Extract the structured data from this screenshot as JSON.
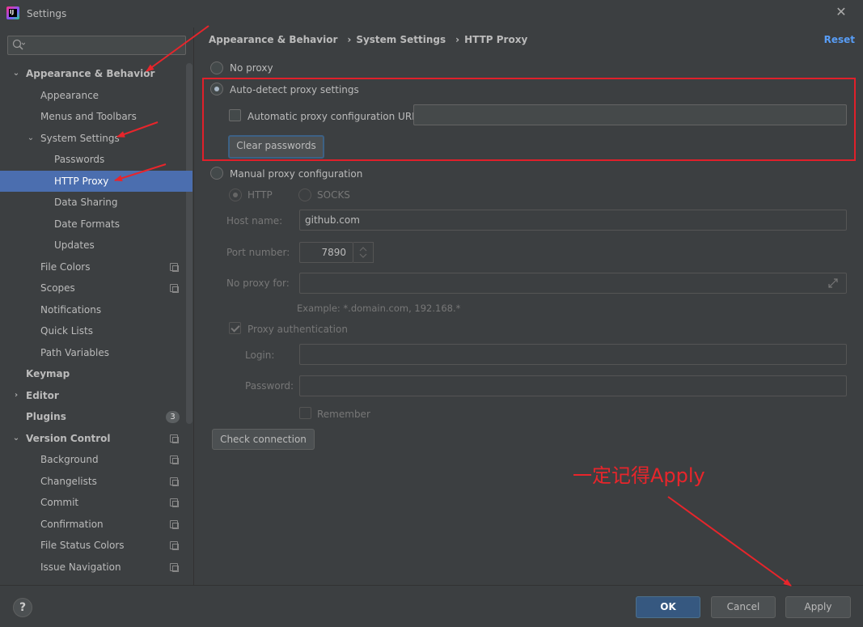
{
  "window": {
    "title": "Settings",
    "logo_text": "IJ"
  },
  "sidebar": {
    "search": {
      "value": "",
      "placeholder": ""
    },
    "items": [
      {
        "label": "Appearance & Behavior",
        "expanded": true
      },
      {
        "label": "Appearance"
      },
      {
        "label": "Menus and Toolbars"
      },
      {
        "label": "System Settings",
        "expanded": true
      },
      {
        "label": "Passwords"
      },
      {
        "label": "HTTP Proxy",
        "selected": true
      },
      {
        "label": "Data Sharing"
      },
      {
        "label": "Date Formats"
      },
      {
        "label": "Updates"
      },
      {
        "label": "File Colors"
      },
      {
        "label": "Scopes"
      },
      {
        "label": "Notifications"
      },
      {
        "label": "Quick Lists"
      },
      {
        "label": "Path Variables"
      },
      {
        "label": "Keymap"
      },
      {
        "label": "Editor",
        "expanded": false
      },
      {
        "label": "Plugins",
        "badge": "3"
      },
      {
        "label": "Version Control",
        "expanded": true
      },
      {
        "label": "Background"
      },
      {
        "label": "Changelists"
      },
      {
        "label": "Commit"
      },
      {
        "label": "Confirmation"
      },
      {
        "label": "File Status Colors"
      },
      {
        "label": "Issue Navigation"
      }
    ]
  },
  "breadcrumb": [
    "Appearance & Behavior",
    "System Settings",
    "HTTP Proxy"
  ],
  "reset_label": "Reset",
  "proxy": {
    "no_proxy_label": "No proxy",
    "auto_detect_label": "Auto-detect proxy settings",
    "auto_config_url_label": "Automatic proxy configuration URL:",
    "auto_config_url_value": "",
    "clear_passwords_label": "Clear passwords",
    "manual_label": "Manual proxy configuration",
    "http_label": "HTTP",
    "socks_label": "SOCKS",
    "host_label": "Host name:",
    "host_value": "github.com",
    "port_label": "Port number:",
    "port_value": "7890",
    "no_proxy_for_label": "No proxy for:",
    "no_proxy_for_value": "",
    "example_text": "Example: *.domain.com, 192.168.*",
    "auth_label": "Proxy authentication",
    "login_label": "Login:",
    "login_value": "",
    "password_label": "Password:",
    "password_value": "",
    "remember_label": "Remember",
    "check_connection_label": "Check connection"
  },
  "annotation_text": "一定记得Apply",
  "footer": {
    "help_label": "?",
    "ok_label": "OK",
    "cancel_label": "Cancel",
    "apply_label": "Apply"
  },
  "colors": {
    "accent": "#4b6eaf",
    "link": "#589df6",
    "annotation_red": "#e8252b",
    "background": "#3c3f41"
  }
}
